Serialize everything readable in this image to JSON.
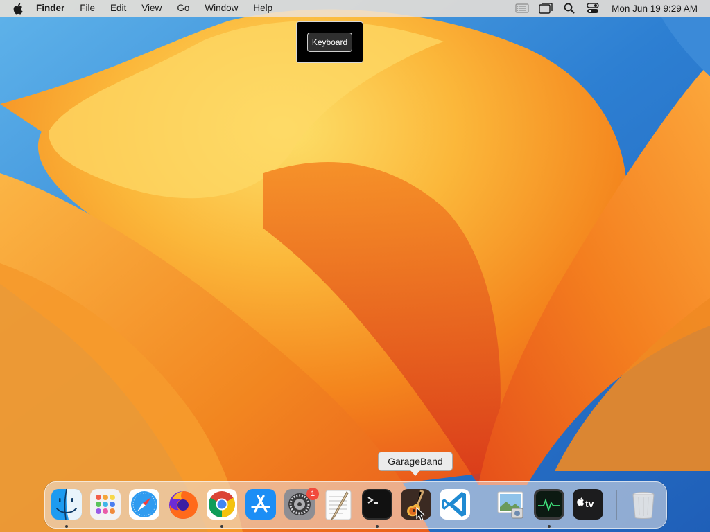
{
  "menubar": {
    "app_name": "Finder",
    "items": [
      "File",
      "Edit",
      "View",
      "Go",
      "Window",
      "Help"
    ],
    "clock": "Mon Jun 19  9:29 AM",
    "status_icons": [
      "list-icon",
      "screen-mirroring-icon",
      "spotlight-search-icon",
      "control-center-icon"
    ]
  },
  "hud": {
    "label": "Keyboard"
  },
  "tooltip": {
    "label": "GarageBand"
  },
  "dock": {
    "apps": [
      {
        "name": "Finder",
        "icon": "finder-icon",
        "running": true
      },
      {
        "name": "Launchpad",
        "icon": "launchpad-icon",
        "running": false
      },
      {
        "name": "Safari",
        "icon": "safari-icon",
        "running": false
      },
      {
        "name": "Firefox",
        "icon": "firefox-icon",
        "running": false
      },
      {
        "name": "Chrome",
        "icon": "chrome-icon",
        "running": true
      },
      {
        "name": "App Store",
        "icon": "app-store-icon",
        "running": false
      },
      {
        "name": "System Settings",
        "icon": "system-settings-icon",
        "running": false,
        "badge": "1"
      },
      {
        "name": "TextEdit",
        "icon": "textedit-icon",
        "running": false
      },
      {
        "name": "Terminal",
        "icon": "terminal-icon",
        "running": true
      },
      {
        "name": "GarageBand",
        "icon": "garageband-icon",
        "running": false
      },
      {
        "name": "Visual Studio Code",
        "icon": "vscode-icon",
        "running": false
      },
      {
        "name": "Preview",
        "icon": "preview-icon",
        "running": false
      },
      {
        "name": "Activity Monitor",
        "icon": "activity-monitor-icon",
        "running": true
      },
      {
        "name": "Apple TV",
        "icon": "apple-tv-icon",
        "running": false
      },
      {
        "name": "Trash",
        "icon": "trash-icon",
        "running": false
      }
    ],
    "settings_badge": "1",
    "tv_label": "tv"
  },
  "colors": {
    "wallpaper_blue": "#2f7fd0",
    "wallpaper_orange": "#f28a1e",
    "wallpaper_yellow": "#fcd85a",
    "wallpaper_red": "#e54a1c",
    "badge_red": "#f24b3c"
  }
}
